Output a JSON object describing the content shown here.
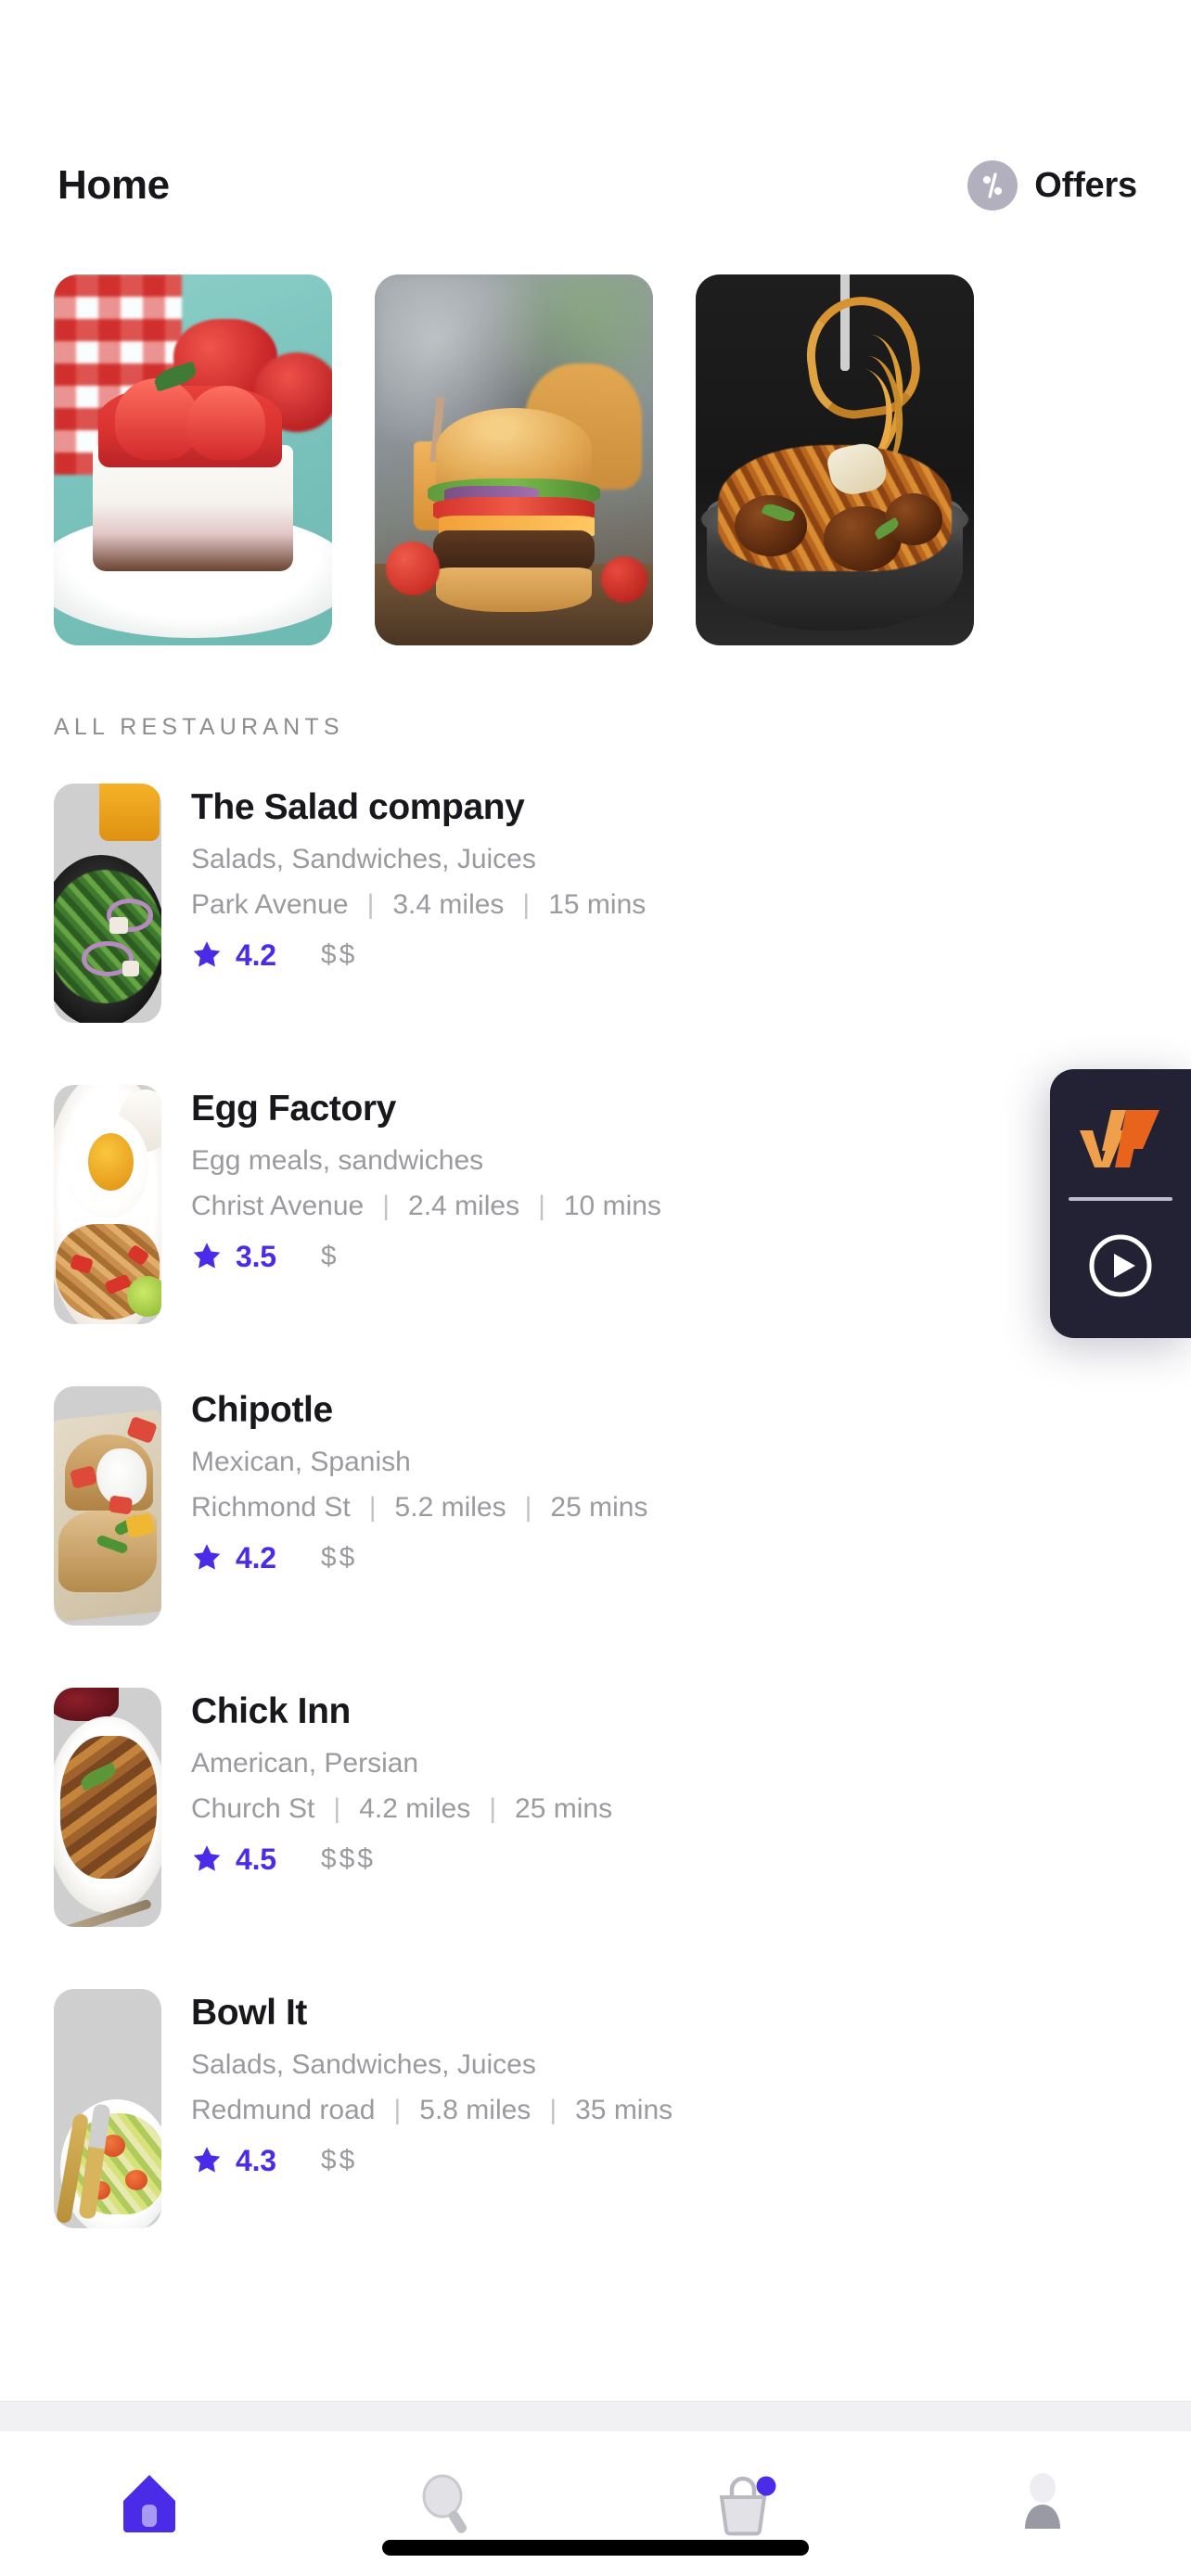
{
  "header": {
    "title": "Home",
    "offers_label": "Offers",
    "offers_icon": "percent-discount-icon"
  },
  "carousel": {
    "items": [
      {
        "id": "promo-cheesecake",
        "alt": "Strawberry cheesecake slice on white plate"
      },
      {
        "id": "promo-burger",
        "alt": "Cheeseburger with lettuce and tomato on wooden board"
      },
      {
        "id": "promo-spaghetti",
        "alt": "Spaghetti and meatballs twirled on a fork"
      }
    ]
  },
  "section": {
    "all_restaurants_label": "ALL RESTAURANTS"
  },
  "restaurants": [
    {
      "name": "The Salad company",
      "cuisine": "Salads, Sandwiches, Juices",
      "location": "Park Avenue",
      "distance": "3.4 miles",
      "time": "15 mins",
      "rating": "4.2",
      "price": "$$",
      "thumb_alt": "Green salad bowl with orange juice"
    },
    {
      "name": "Egg Factory",
      "cuisine": "Egg meals, sandwiches",
      "location": "Christ Avenue",
      "distance": "2.4 miles",
      "time": "10 mins",
      "rating": "3.5",
      "price": "$",
      "thumb_alt": "Fried egg over rice with chili"
    },
    {
      "name": "Chipotle",
      "cuisine": "Mexican, Spanish",
      "location": "Richmond St",
      "distance": "5.2 miles",
      "time": "25 mins",
      "rating": "4.2",
      "price": "$$",
      "thumb_alt": "Tacos with sour cream and salsa"
    },
    {
      "name": "Chick Inn",
      "cuisine": "American, Persian",
      "location": "Church St",
      "distance": "4.2 miles",
      "time": "25 mins",
      "rating": "4.5",
      "price": "$$$",
      "thumb_alt": "Roast chicken on a white platter"
    },
    {
      "name": "Bowl It",
      "cuisine": "Salads, Sandwiches, Juices",
      "location": "Redmund road",
      "distance": "5.8 miles",
      "time": "35 mins",
      "rating": "4.3",
      "price": "$$",
      "thumb_alt": "Fresh salad plate with gold fork and knife"
    }
  ],
  "separator": "|",
  "floating_widget": {
    "logo_icon": "w-brand-logo-icon",
    "play_icon": "play-circle-icon"
  },
  "tabbar": {
    "items": [
      {
        "icon": "home-icon",
        "active": true,
        "badge": false
      },
      {
        "icon": "search-icon",
        "active": false,
        "badge": false
      },
      {
        "icon": "shopping-bag-icon",
        "active": false,
        "badge": true
      },
      {
        "icon": "profile-icon",
        "active": false,
        "badge": false
      }
    ]
  },
  "colors": {
    "accent_purple": "#4A2CE8",
    "text_primary": "#18181C",
    "text_muted": "#9A9A9F",
    "widget_bg": "#232234",
    "logo_orange_light": "#F0A04B",
    "logo_orange_dark": "#E8641C",
    "band_grey": "#F1F1F4"
  }
}
